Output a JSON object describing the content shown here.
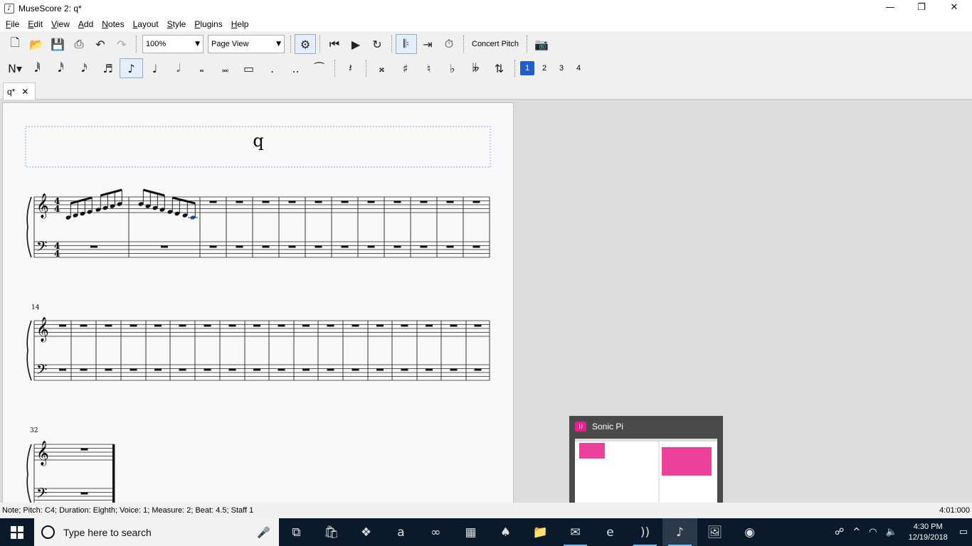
{
  "window": {
    "title": "MuseScore 2: q*",
    "app_icon": "musescore-icon"
  },
  "menu": [
    "File",
    "Edit",
    "View",
    "Add",
    "Notes",
    "Layout",
    "Style",
    "Plugins",
    "Help"
  ],
  "toolbar1": {
    "zoom": "100%",
    "view_mode": "Page View",
    "concert_pitch": "Concert Pitch"
  },
  "toolbar2": {
    "voices": [
      "1",
      "2",
      "3",
      "4"
    ],
    "active_voice": "1"
  },
  "tab": {
    "label": "q*"
  },
  "score": {
    "title": "q",
    "time_signature": "4/4",
    "system_numbers": [
      "14",
      "32"
    ]
  },
  "status": {
    "left": "Note; Pitch: C4; Duration: Eighth; Voice: 1;  Measure: 2; Beat: 4.5; Staff 1",
    "right": "4:01:000"
  },
  "taskbar": {
    "search_placeholder": "Type here to search",
    "time": "4:30 PM",
    "date": "12/19/2018"
  },
  "popup": {
    "title": "Sonic Pi"
  },
  "colors": {
    "selection": "#1f5fc9",
    "popup_accent": "#e91e8c"
  }
}
